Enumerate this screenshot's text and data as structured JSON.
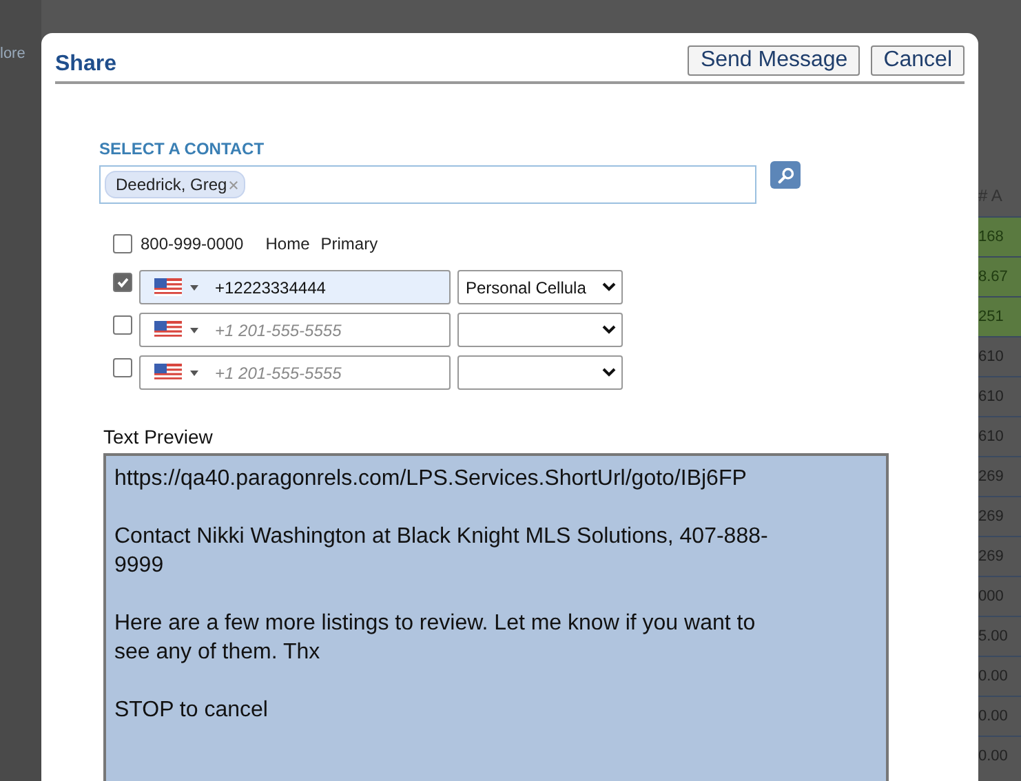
{
  "background": {
    "menu_text": "lore",
    "column_header": "# A",
    "cells": [
      {
        "text": "168",
        "highlighted": true
      },
      {
        "text": "8.67",
        "highlighted": true
      },
      {
        "text": "251",
        "highlighted": true
      },
      {
        "text": "610",
        "highlighted": false
      },
      {
        "text": "610",
        "highlighted": false
      },
      {
        "text": "610",
        "highlighted": false
      },
      {
        "text": "269",
        "highlighted": false
      },
      {
        "text": "269",
        "highlighted": false
      },
      {
        "text": "269",
        "highlighted": false
      },
      {
        "text": "000",
        "highlighted": false
      },
      {
        "text": "5.00",
        "highlighted": false
      },
      {
        "text": "0.00",
        "highlighted": false
      },
      {
        "text": "0.00",
        "highlighted": false
      },
      {
        "text": "0.00",
        "highlighted": false
      }
    ]
  },
  "dialog": {
    "title": "Share",
    "buttons": [
      "Send Message",
      "Cancel"
    ],
    "contact_label": "SELECT A CONTACT",
    "contact_tags": [
      "Deedrick, Greg"
    ],
    "existing_phone": {
      "checked": false,
      "number": "800-999-0000",
      "type": "Home",
      "flag": "Primary"
    },
    "phone_rows": [
      {
        "checked": true,
        "value": "+12223334444",
        "type": "Personal Cellula"
      },
      {
        "checked": false,
        "placeholder": "+1 201-555-5555"
      },
      {
        "checked": false,
        "placeholder": "+1 201-555-5555"
      }
    ],
    "preview_label": "Text Preview",
    "preview_paragraphs": [
      "https://qa40.paragonrels.com/LPS.Services.ShortUrl/goto/IBj6FP",
      "Contact Nikki Washington at Black Knight MLS Solutions, 407-888-9999",
      "Here are a few more listings to review. Let me know if you want to see any of them. Thx",
      "STOP to cancel"
    ]
  }
}
